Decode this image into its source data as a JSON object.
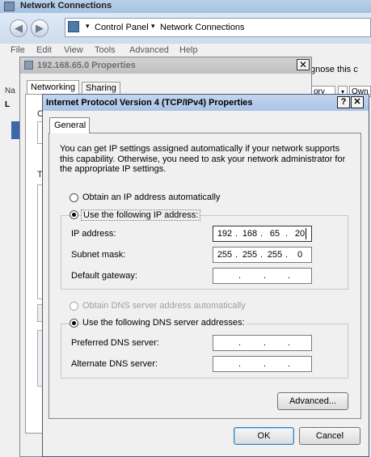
{
  "explorer": {
    "title": "Network Connections",
    "breadcrumb": [
      "Control Panel",
      "Network Connections"
    ],
    "menu": [
      "File",
      "Edit",
      "View",
      "Tools",
      "Advanced",
      "Help"
    ],
    "command_text": "gnose this c",
    "right_header_partial_1": "ory",
    "right_header_partial_2": "Own",
    "left_header_partial": "Na",
    "left_item_partial": "L"
  },
  "properties_dialog": {
    "title": "192.168.65.0 Properties",
    "close": "✕",
    "tabs": [
      "Networking",
      "Sharing"
    ],
    "partial_label_1": "C",
    "partial_label_2": "T"
  },
  "ipv4_dialog": {
    "title": "Internet Protocol Version 4 (TCP/IPv4) Properties",
    "help": "?",
    "close": "✕",
    "tab": "General",
    "description": "You can get IP settings assigned automatically if your network supports this capability. Otherwise, you need to ask your network administrator for the appropriate IP settings.",
    "ip_mode": {
      "auto_label": "Obtain an IP address automatically",
      "manual_label": "Use the following IP address:",
      "selected": "manual"
    },
    "ip_fields": [
      {
        "label": "IP address:",
        "octets": [
          "192",
          "168",
          "65",
          "20"
        ]
      },
      {
        "label": "Subnet mask:",
        "octets": [
          "255",
          "255",
          "255",
          "0"
        ]
      },
      {
        "label": "Default gateway:",
        "octets": [
          "",
          "",
          "",
          ""
        ]
      }
    ],
    "dns_mode": {
      "auto_label": "Obtain DNS server address automatically",
      "manual_label": "Use the following DNS server addresses:",
      "selected": "manual"
    },
    "dns_fields": [
      {
        "label": "Preferred DNS server:",
        "octets": [
          "",
          "",
          "",
          ""
        ]
      },
      {
        "label": "Alternate DNS server:",
        "octets": [
          "",
          "",
          "",
          ""
        ]
      }
    ],
    "advanced_button": "Advanced...",
    "ok_button": "OK",
    "cancel_button": "Cancel"
  }
}
